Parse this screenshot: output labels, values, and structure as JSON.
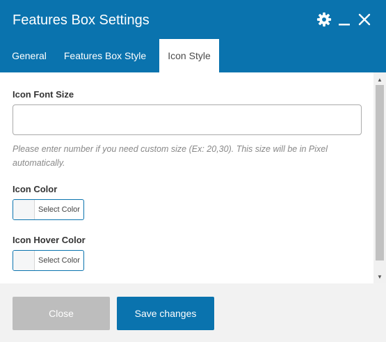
{
  "dialog": {
    "title": "Features Box Settings",
    "icons": [
      "gear-icon",
      "minimize-icon",
      "close-icon"
    ],
    "colors": {
      "header": "#0a73ae",
      "accent": "#0a73ae",
      "footer": "#f2f2f2",
      "close_btn": "#bdbdbd"
    }
  },
  "tabs": [
    {
      "label": "General",
      "active": false
    },
    {
      "label": "Features Box Style",
      "active": false
    },
    {
      "label": "Icon Style",
      "active": true
    }
  ],
  "form": {
    "font_size": {
      "label": "Icon Font Size",
      "value": "",
      "help": "Please enter number if you need custom size (Ex: 20,30). This size will be in Pixel automatically."
    },
    "icon_color": {
      "label": "Icon Color",
      "button_label": "Select Color"
    },
    "icon_hover_color": {
      "label": "Icon Hover Color",
      "button_label": "Select Color"
    }
  },
  "footer": {
    "close_label": "Close",
    "save_label": "Save changes"
  }
}
